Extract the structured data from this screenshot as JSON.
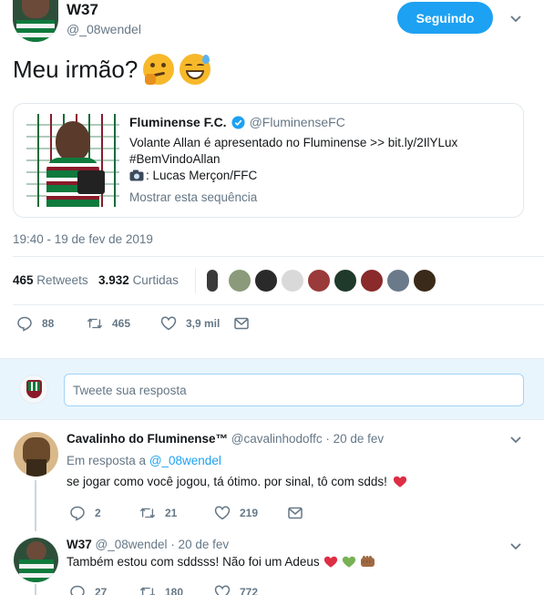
{
  "main_tweet": {
    "author_name": "W37",
    "author_handle": "@_08wendel",
    "follow_button": "Seguindo",
    "text": "Meu irmão?",
    "emojis": [
      "thinking-face-icon",
      "grinning-sweat-icon"
    ],
    "timestamp": "19:40 - 19 de fev de 2019",
    "retweets_count": "465",
    "retweets_label": "Retweets",
    "likes_count": "3.932",
    "likes_label": "Curtidas",
    "actions": {
      "replies": "88",
      "retweets": "465",
      "likes": "3,9 mil"
    }
  },
  "quoted_tweet": {
    "author_name": "Fluminense F.C.",
    "author_handle": "@FluminenseFC",
    "line1": "Volante Allan é apresentado no Fluminense >> bit.ly/2IlYLux",
    "line2": "#BemVindoAllan",
    "line3": ": Lucas Merçon/FFC",
    "show_thread": "Mostrar esta sequência"
  },
  "reply_box": {
    "placeholder": "Tweete sua resposta"
  },
  "replies": [
    {
      "author_name": "Cavalinho do Fluminense™",
      "author_handle": "@cavalinhodoffc",
      "date": "· 20 de fev",
      "in_reply_prefix": "Em resposta a",
      "in_reply_handle": "@_08wendel",
      "text": "se jogar como você jogou, tá ótimo. por sinal, tô com sdds!",
      "actions": {
        "replies": "2",
        "retweets": "21",
        "likes": "219"
      }
    },
    {
      "author_name": "W37",
      "author_handle": "@_08wendel",
      "date": "· 20 de fev",
      "text": "Também estou com sddsss! Não foi um Adeus",
      "actions": {
        "replies": "27",
        "retweets": "180",
        "likes": "772"
      }
    }
  ],
  "colors": {
    "accent": "#1da1f2",
    "muted": "#657786",
    "heart": "#e0245e",
    "divider": "#e6ecf0"
  }
}
